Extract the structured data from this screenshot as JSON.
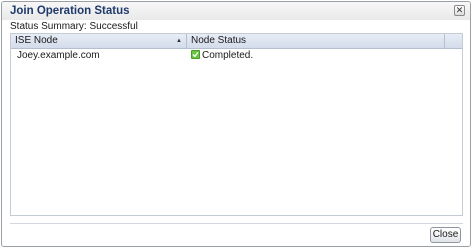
{
  "dialog": {
    "title": "Join Operation Status",
    "close_icon": "close-icon",
    "summary": "Status Summary: Successful",
    "close_label": "Close"
  },
  "grid": {
    "columns": [
      {
        "label": "ISE Node",
        "sort": "ascending"
      },
      {
        "label": "Node Status"
      }
    ],
    "rows": [
      {
        "node": "Joey.example.com",
        "status": "Completed.",
        "status_icon": "check-icon"
      }
    ]
  },
  "colors": {
    "title": "#1f3a6b",
    "header_bg": "#dbe3ee",
    "success": "#6cc644"
  }
}
